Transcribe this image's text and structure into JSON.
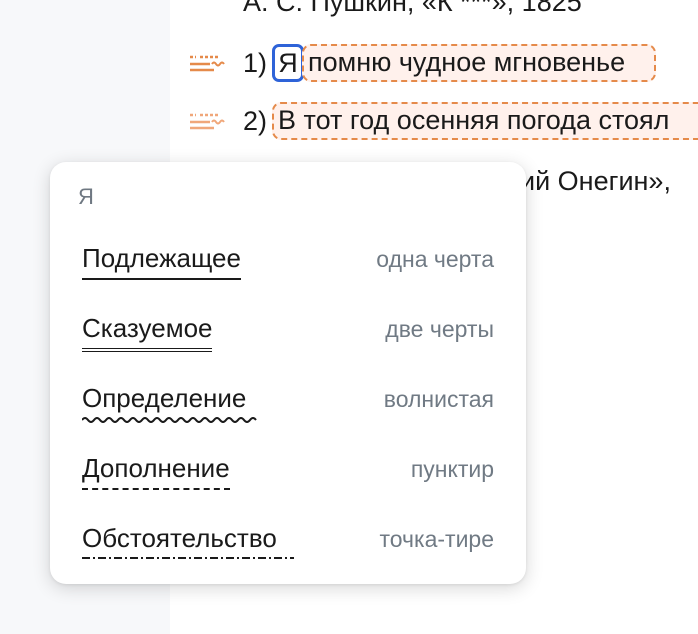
{
  "document": {
    "caption_top": "А. С. Пушкин, «К ***», 1825",
    "caption_second": "ий Онегин»,",
    "sentences": [
      {
        "number": "1)",
        "first_word": "Я",
        "rest": "помню чудное мгновенье"
      },
      {
        "number": "2)",
        "text": "В тот год осенняя погода стоял"
      }
    ]
  },
  "popup": {
    "title": "Я",
    "options": [
      {
        "label": "Подлежащее",
        "hint": "одна черта"
      },
      {
        "label": "Сказуемое",
        "hint": "две черты"
      },
      {
        "label": "Определение",
        "hint": "волнистая"
      },
      {
        "label": "Дополнение",
        "hint": "пунктир"
      },
      {
        "label": "Обстоятельство",
        "hint": "точка-тире"
      }
    ]
  },
  "colors": {
    "accent_orange": "#e58a4a",
    "selection_blue": "#2e63d8",
    "highlight_bg": "#fff1ec"
  },
  "icons": {
    "sentence_marker": "sentence-parse-icon"
  }
}
